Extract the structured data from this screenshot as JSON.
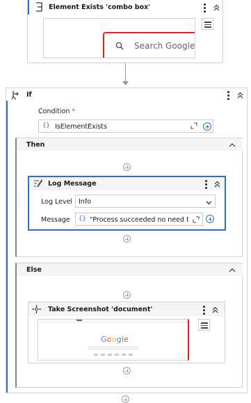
{
  "element_exists": {
    "title": "Element Exists 'combo box'",
    "preview_search": "Search Google"
  },
  "if_activity": {
    "title": "If",
    "condition_label": "Condition",
    "required_mark": "*",
    "condition_value": "IsElementExists"
  },
  "then_branch": {
    "title": "Then",
    "log_message": {
      "title": "Log Message",
      "level_label": "Log Level",
      "level_value": "Info",
      "message_label": "Message",
      "message_value": "\"Process succeeded no need to"
    }
  },
  "else_branch": {
    "title": "Else",
    "take_screenshot": {
      "title": "Take Screenshot 'document'",
      "preview_logo": "Google"
    }
  },
  "icons": {
    "curly": "{}",
    "expand": "⤢"
  },
  "colors": {
    "accent": "#2a72c4",
    "selection_border": "#2a72c4",
    "highlight_red": "#e02020",
    "branch_header": "#f3f4f6"
  }
}
